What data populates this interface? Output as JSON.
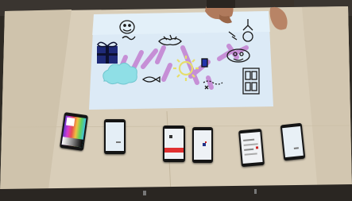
{
  "scene": {
    "description_label": "",
    "colors": {
      "projection": "#dfeefa",
      "stroke_purple": "#c890d8",
      "sun_yellow": "#e8e070",
      "cloud_cyan": "#90e0e8",
      "gift_blue": "#202a78",
      "cardboard": "#d8cdb8"
    },
    "phones": [
      {
        "name": "phone-color-picker",
        "content": "color-palette"
      },
      {
        "name": "phone-2",
        "content": "light-screen"
      },
      {
        "name": "phone-3",
        "content": "red-stripe"
      },
      {
        "name": "phone-4",
        "content": "blue-dot"
      },
      {
        "name": "phone-5",
        "content": "text-list"
      },
      {
        "name": "phone-6",
        "content": "light-screen"
      }
    ],
    "icons": [
      "gift-icon",
      "cloud-icon",
      "sun-icon",
      "door-icon",
      "hands-icon",
      "face-icon",
      "flower-icon",
      "fish-icon",
      "pencil-icon"
    ]
  }
}
